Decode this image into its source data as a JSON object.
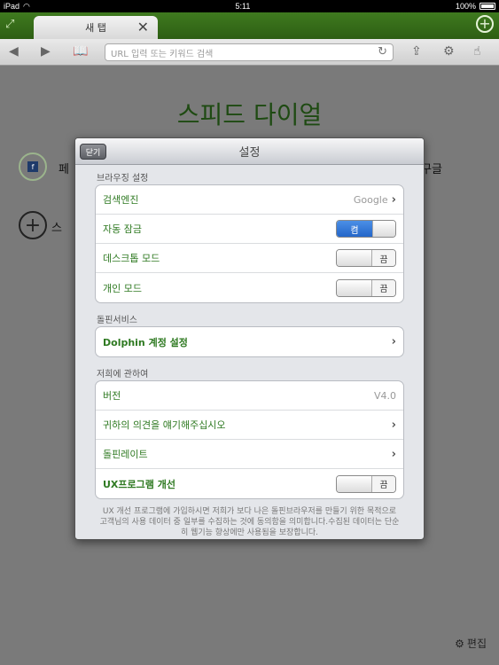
{
  "status": {
    "device": "iPad",
    "time": "5:11",
    "battery": "100%"
  },
  "tab": {
    "label": "새 탭",
    "close": "✕"
  },
  "toolbar": {
    "url_placeholder": "URL 입력 또는 키워드 검색"
  },
  "speed_dial": {
    "title": "스피드 다이얼",
    "item1_label": "페",
    "item1_right_label": "구글",
    "add_label": "스"
  },
  "footer": {
    "edit_label": "편집"
  },
  "settings": {
    "title": "설정",
    "close_label": "닫기",
    "sections": {
      "browsing": {
        "title": "브라우징 설정",
        "search_engine": {
          "label": "검색엔진",
          "value": "Google"
        },
        "auto_lock": {
          "label": "자동 잠금",
          "state": "켬"
        },
        "desktop_mode": {
          "label": "데스크톱 모드",
          "state": "끔"
        },
        "private_mode": {
          "label": "개인 모드",
          "state": "끔"
        }
      },
      "service": {
        "title": "돌핀서비스",
        "account": {
          "label": "Dolphin 계정 설정"
        }
      },
      "about": {
        "title": "저희에 관하여",
        "version": {
          "label": "버전",
          "value": "V4.0"
        },
        "feedback": {
          "label": "귀하의 의견을 얘기해주십시오"
        },
        "rate": {
          "label": "돌핀레이트"
        },
        "ux": {
          "label": "UX프로그램 개선",
          "state": "끔"
        }
      }
    },
    "note": "UX 개선 프로그램에 가입하시면 저희가 보다 나은 돌핀브라우저를 만들기 위한 목적으로 고객님의 사용 데이터 중 일부를 수집하는 것에 동의함을 의미합니다.수집된 데이터는 단순히 웹기능 향상에만 사용됨을 보장합니다."
  },
  "colors": {
    "accent_green": "#2f7a22",
    "toggle_on": "#2466c9",
    "tabbar": "#3f7a1f"
  }
}
